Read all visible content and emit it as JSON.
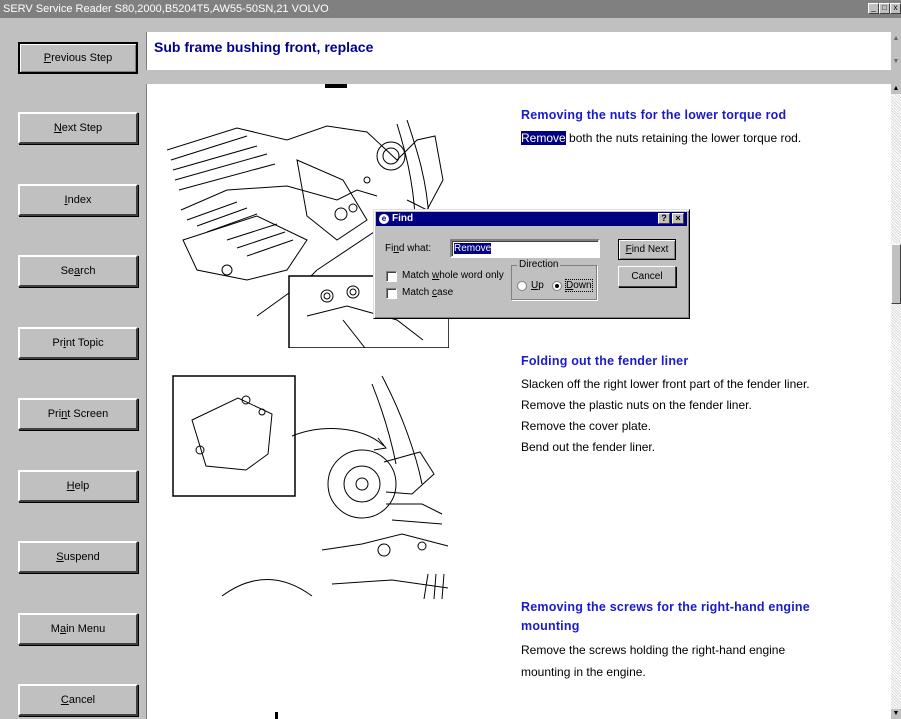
{
  "window": {
    "title": "SERV Service Reader S80,2000,B5204T5,AW55-50SN,21 VOLVO"
  },
  "nav": {
    "previous_step": {
      "pre": "",
      "key": "P",
      "post": "revious Step"
    },
    "next_step": {
      "pre": "",
      "key": "N",
      "post": "ext Step"
    },
    "index": {
      "pre": "",
      "key": "I",
      "post": "ndex"
    },
    "search": {
      "pre": "Se",
      "key": "a",
      "post": "rch"
    },
    "print_topic": {
      "pre": "Pr",
      "key": "i",
      "post": "nt Topic"
    },
    "print_screen": {
      "pre": "Pri",
      "key": "n",
      "post": "t Screen"
    },
    "help": {
      "pre": "",
      "key": "H",
      "post": "elp"
    },
    "suspend": {
      "pre": "",
      "key": "S",
      "post": "uspend"
    },
    "main_menu": {
      "pre": "M",
      "key": "a",
      "post": "in Menu"
    },
    "cancel": {
      "pre": "",
      "key": "C",
      "post": "ancel"
    }
  },
  "header": {
    "title": "Sub frame bushing front, replace"
  },
  "sections": [
    {
      "title": "Removing the nuts for the lower torque rod",
      "highlight": "Remove",
      "line1_rest": " both the nuts retaining the lower torque rod."
    },
    {
      "title": "Folding out the fender liner",
      "lines": [
        "Slacken off the right lower front part of the fender liner.",
        "Remove the plastic nuts on the fender liner.",
        "Remove the cover plate.",
        "Bend out the fender liner."
      ]
    },
    {
      "title_line1": "Removing the screws for the right-hand engine",
      "title_line2": "mounting",
      "lines": [
        "Remove the screws holding the right-hand engine",
        "mounting in the engine."
      ]
    }
  ],
  "find_dialog": {
    "title": "Find",
    "help_btn": "?",
    "close_btn": "×",
    "find_what": {
      "pre": "Fi",
      "key": "n",
      "post": "d what:"
    },
    "find_value": "Remove",
    "find_next": {
      "pre": "",
      "key": "F",
      "post": "ind Next"
    },
    "cancel": "Cancel",
    "match_whole": {
      "pre": "Match ",
      "key": "w",
      "post": "hole word only"
    },
    "match_case": {
      "pre": "Match ",
      "key": "c",
      "post": "ase"
    },
    "direction_label": "Direction",
    "up": {
      "pre": "",
      "key": "U",
      "post": "p"
    },
    "down": {
      "pre": "",
      "key": "D",
      "post": "own"
    },
    "direction_selected": "Down"
  },
  "colors": {
    "accent_blue": "#1a1acc",
    "header_title": "#00008b",
    "selection": "#000080"
  }
}
